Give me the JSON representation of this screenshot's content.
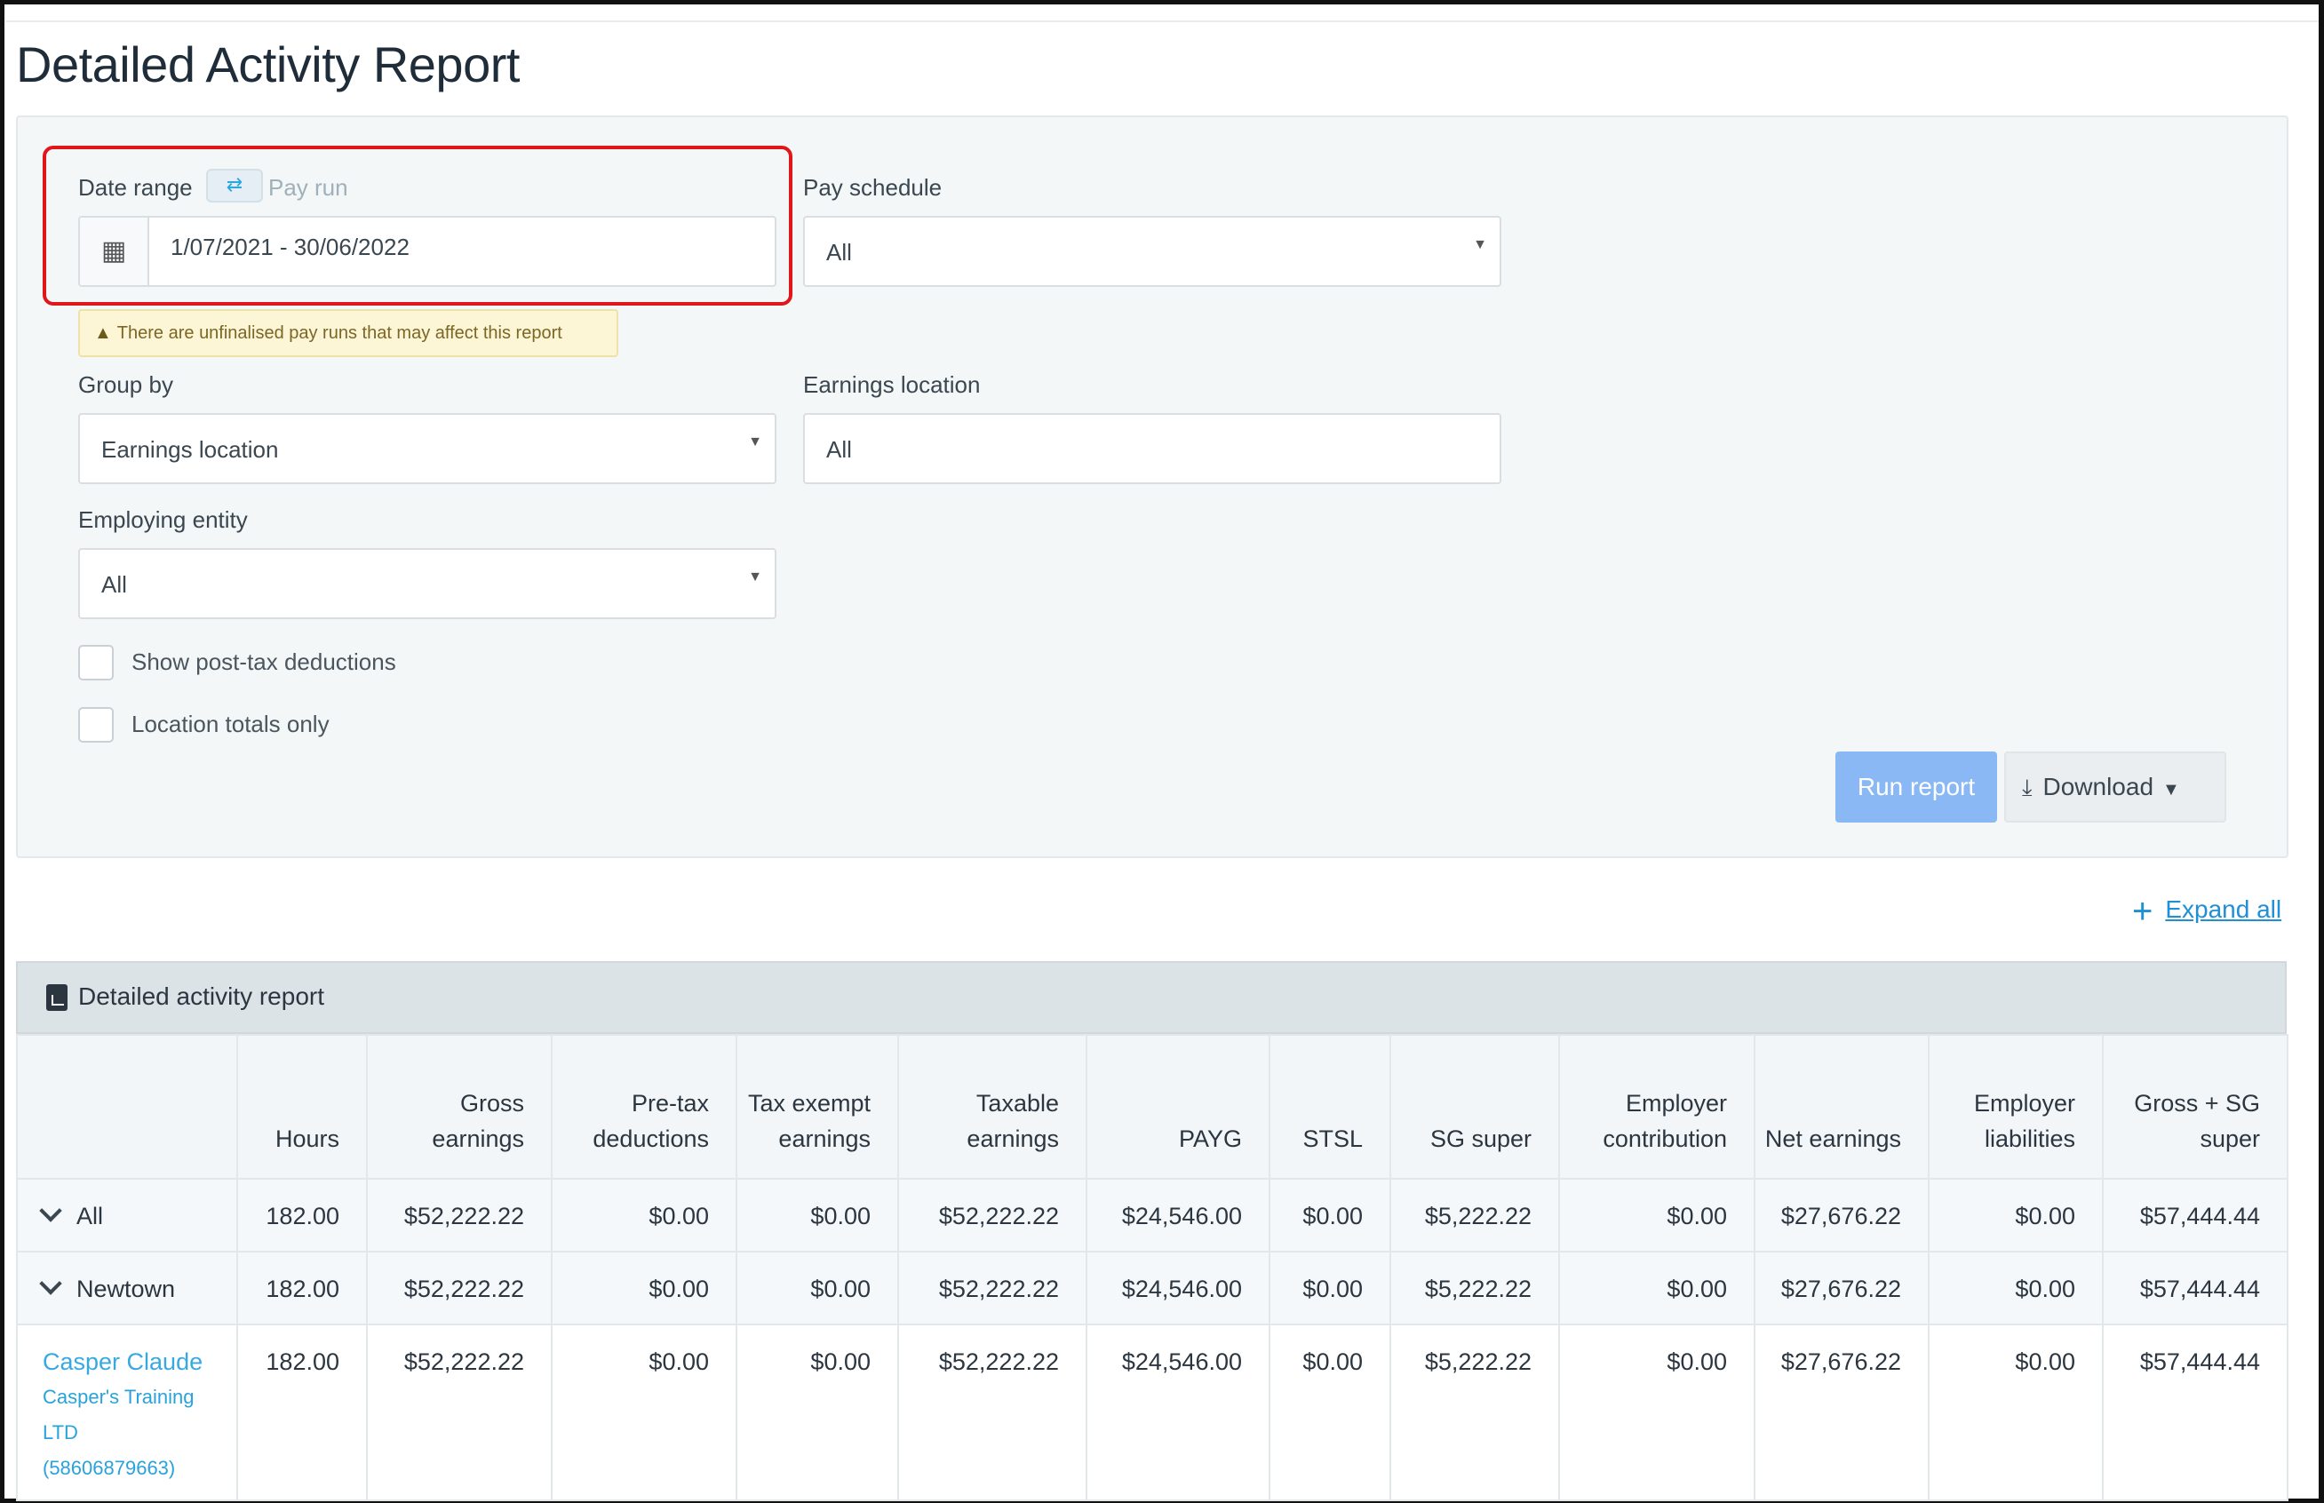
{
  "page": {
    "title": "Detailed Activity Report"
  },
  "filters": {
    "date_range_label": "Date range",
    "pay_run_label": "Pay run",
    "date_range_value": "1/07/2021 - 30/06/2022",
    "pay_schedule_label": "Pay schedule",
    "pay_schedule_value": "All",
    "warning": "There are unfinalised pay runs that may affect this report",
    "group_by_label": "Group by",
    "group_by_value": "Earnings location",
    "earnings_location_label": "Earnings location",
    "earnings_location_value": "All",
    "employing_entity_label": "Employing entity",
    "employing_entity_value": "All",
    "show_post_tax_label": "Show post-tax deductions",
    "show_post_tax_checked": false,
    "location_totals_label": "Location totals only",
    "location_totals_checked": false,
    "run_report_label": "Run report",
    "download_label": "Download"
  },
  "expand_all_label": "Expand all",
  "report": {
    "title": "Detailed activity report",
    "columns": [
      "",
      "Hours",
      "Gross earnings",
      "Pre-tax deductions",
      "Tax exempt earnings",
      "Taxable earnings",
      "PAYG",
      "STSL",
      "SG super",
      "Employer contribution",
      "Net earnings",
      "Employer liabilities",
      "Gross + SG super"
    ],
    "rows": [
      {
        "label": "All",
        "values": [
          "182.00",
          "$52,222.22",
          "$0.00",
          "$0.00",
          "$52,222.22",
          "$24,546.00",
          "$0.00",
          "$5,222.22",
          "$0.00",
          "$27,676.22",
          "$0.00",
          "$57,444.44"
        ]
      },
      {
        "label": "Newtown",
        "values": [
          "182.00",
          "$52,222.22",
          "$0.00",
          "$0.00",
          "$52,222.22",
          "$24,546.00",
          "$0.00",
          "$5,222.22",
          "$0.00",
          "$27,676.22",
          "$0.00",
          "$57,444.44"
        ]
      },
      {
        "label": "Casper Claude",
        "sublabel": "Casper's Training LTD (58606879663)",
        "values": [
          "182.00",
          "$52,222.22",
          "$0.00",
          "$0.00",
          "$52,222.22",
          "$24,546.00",
          "$0.00",
          "$5,222.22",
          "$0.00",
          "$27,676.22",
          "$0.00",
          "$57,444.44"
        ]
      }
    ]
  },
  "colors": {
    "accent": "#38a9e0",
    "highlight": "#e0161b",
    "run_button": "#8ab8f5"
  }
}
